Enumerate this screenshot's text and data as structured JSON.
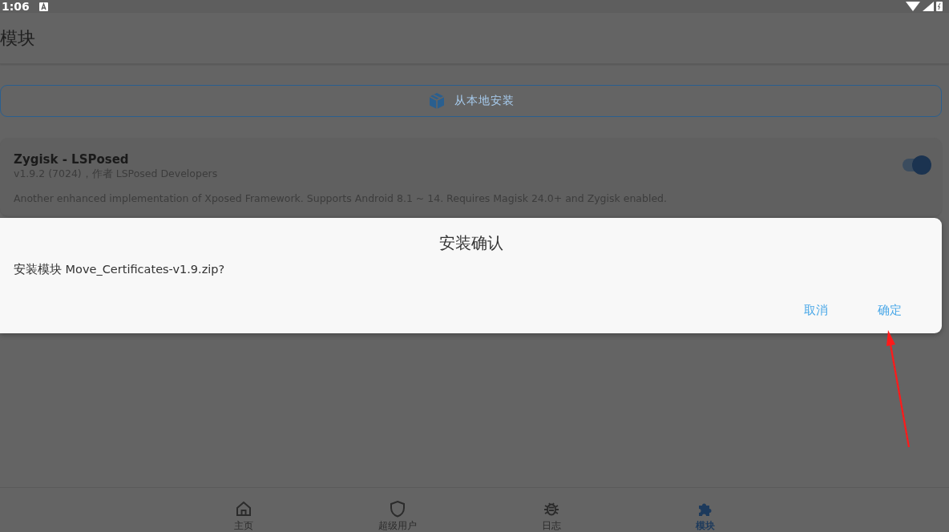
{
  "status_bar": {
    "time": "1:06"
  },
  "app_bar": {
    "title": "模块"
  },
  "install_button": {
    "label": "从本地安装"
  },
  "modules": [
    {
      "name": "Zygisk - LSPosed",
      "meta": "v1.9.2 (7024)，作者 LSPosed Developers",
      "description": "Another enhanced implementation of Xposed Framework. Supports Android 8.1 ~ 14. Requires Magisk 24.0+ and Zygisk enabled.",
      "enabled": true
    }
  ],
  "dialog": {
    "title": "安装确认",
    "message": "安装模块 Move_Certificates-v1.9.zip?",
    "buttons": [
      "取消",
      "确定"
    ]
  },
  "nav": [
    {
      "kind": "home",
      "label": "主页",
      "selected": false
    },
    {
      "kind": "shield",
      "label": "超级用户",
      "selected": false
    },
    {
      "kind": "bug",
      "label": "日志",
      "selected": false
    },
    {
      "kind": "puzzle",
      "label": "模块",
      "selected": true
    }
  ]
}
